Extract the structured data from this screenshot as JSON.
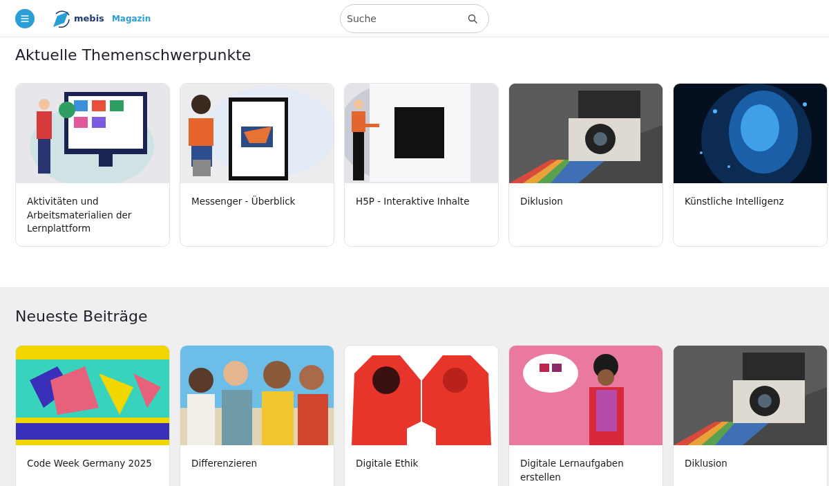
{
  "header": {
    "logo_name": "mebis",
    "logo_suffix": "Magazin",
    "search": {
      "placeholder": "Suche"
    }
  },
  "sections": [
    {
      "title": "Aktuelle Themenschwerpunkte",
      "cards": [
        {
          "title": "Aktivitäten und Arbeitsmaterialien der Lernplattform"
        },
        {
          "title": "Messenger - Überblick"
        },
        {
          "title": "H5P - Interaktive Inhalte"
        },
        {
          "title": "Diklusion"
        },
        {
          "title": "Künstliche Intelligenz"
        }
      ]
    },
    {
      "title": "Neueste Beiträge",
      "cards": [
        {
          "title": "Code Week Germany 2025"
        },
        {
          "title": "Differenzieren"
        },
        {
          "title": "Digitale Ethik"
        },
        {
          "title": "Digitale Lernaufgaben erstellen"
        },
        {
          "title": "Diklusion"
        }
      ]
    }
  ]
}
